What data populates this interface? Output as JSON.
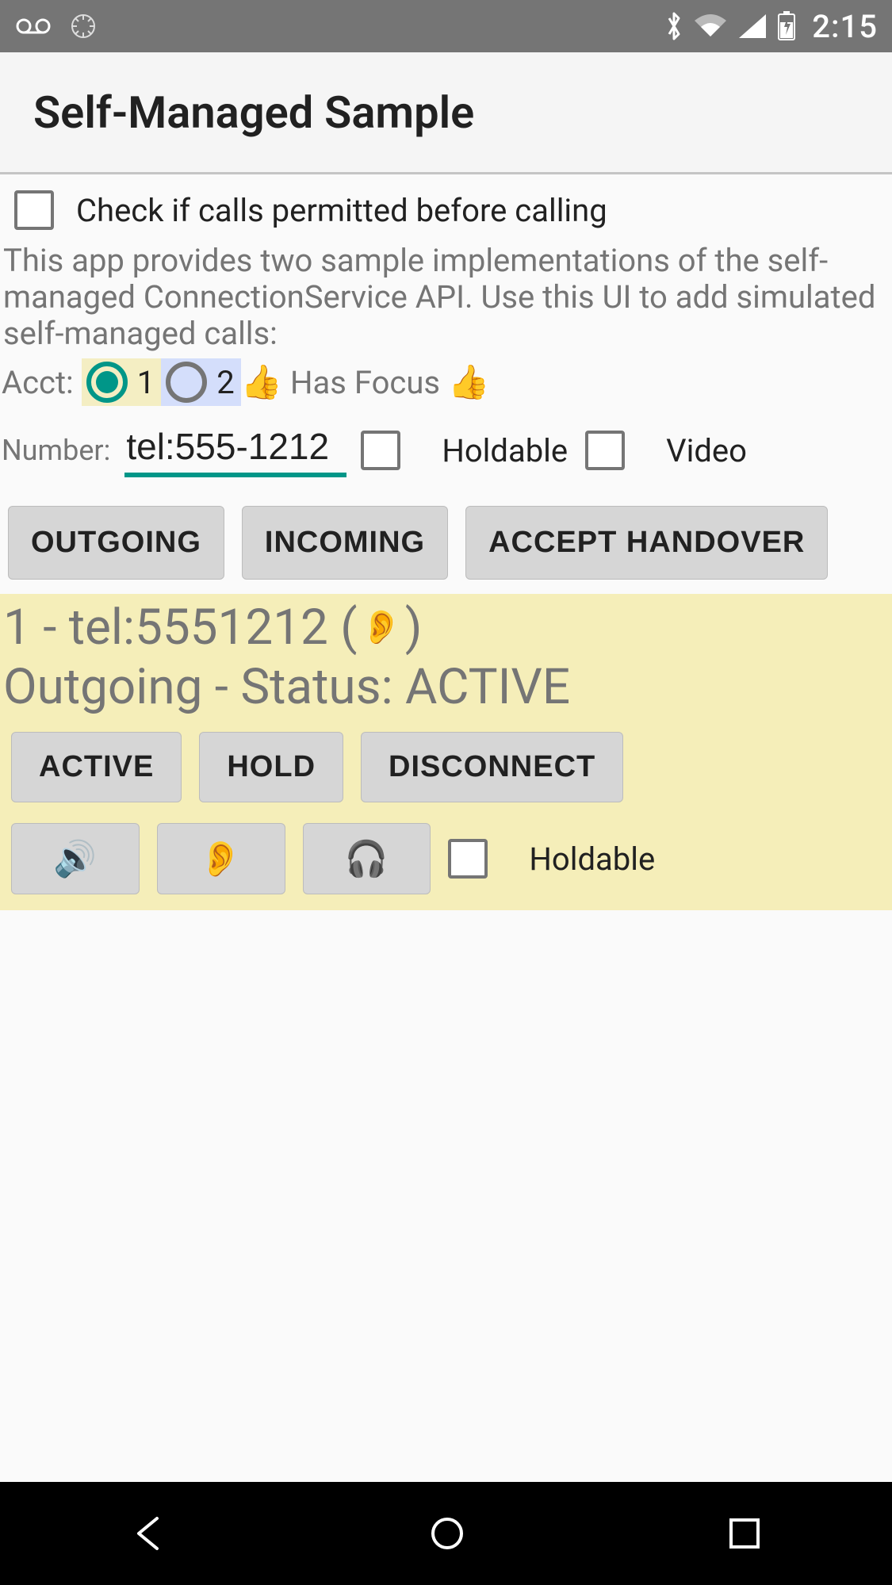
{
  "statusbar": {
    "clock": "2:15"
  },
  "appbar": {
    "title": "Self-Managed Sample"
  },
  "check_permitted": {
    "label": "Check if calls permitted before calling"
  },
  "description": "This app provides two sample implementations of the self-managed ConnectionService API.  Use this UI to add simulated self-managed calls:",
  "acct": {
    "label": "Acct:",
    "opt1": "1",
    "opt2": "2",
    "focus_text": "Has Focus",
    "thumb": "👍"
  },
  "number": {
    "label": "Number:",
    "value": "tel:555-1212",
    "holdable_label": "Holdable",
    "video_label": "Video"
  },
  "buttons": {
    "outgoing": "OUTGOING",
    "incoming": "INCOMING",
    "accept_handover": "ACCEPT HANDOVER"
  },
  "call": {
    "line1_prefix": "1 - tel:5551212 (",
    "line1_ear": "👂",
    "line1_suffix": ")",
    "line2": "Outgoing - Status: ACTIVE",
    "active": "ACTIVE",
    "hold": "HOLD",
    "disconnect": "DISCONNECT",
    "speaker": "🔊",
    "ear": "👂",
    "headphones": "🎧",
    "holdable_label": "Holdable"
  }
}
